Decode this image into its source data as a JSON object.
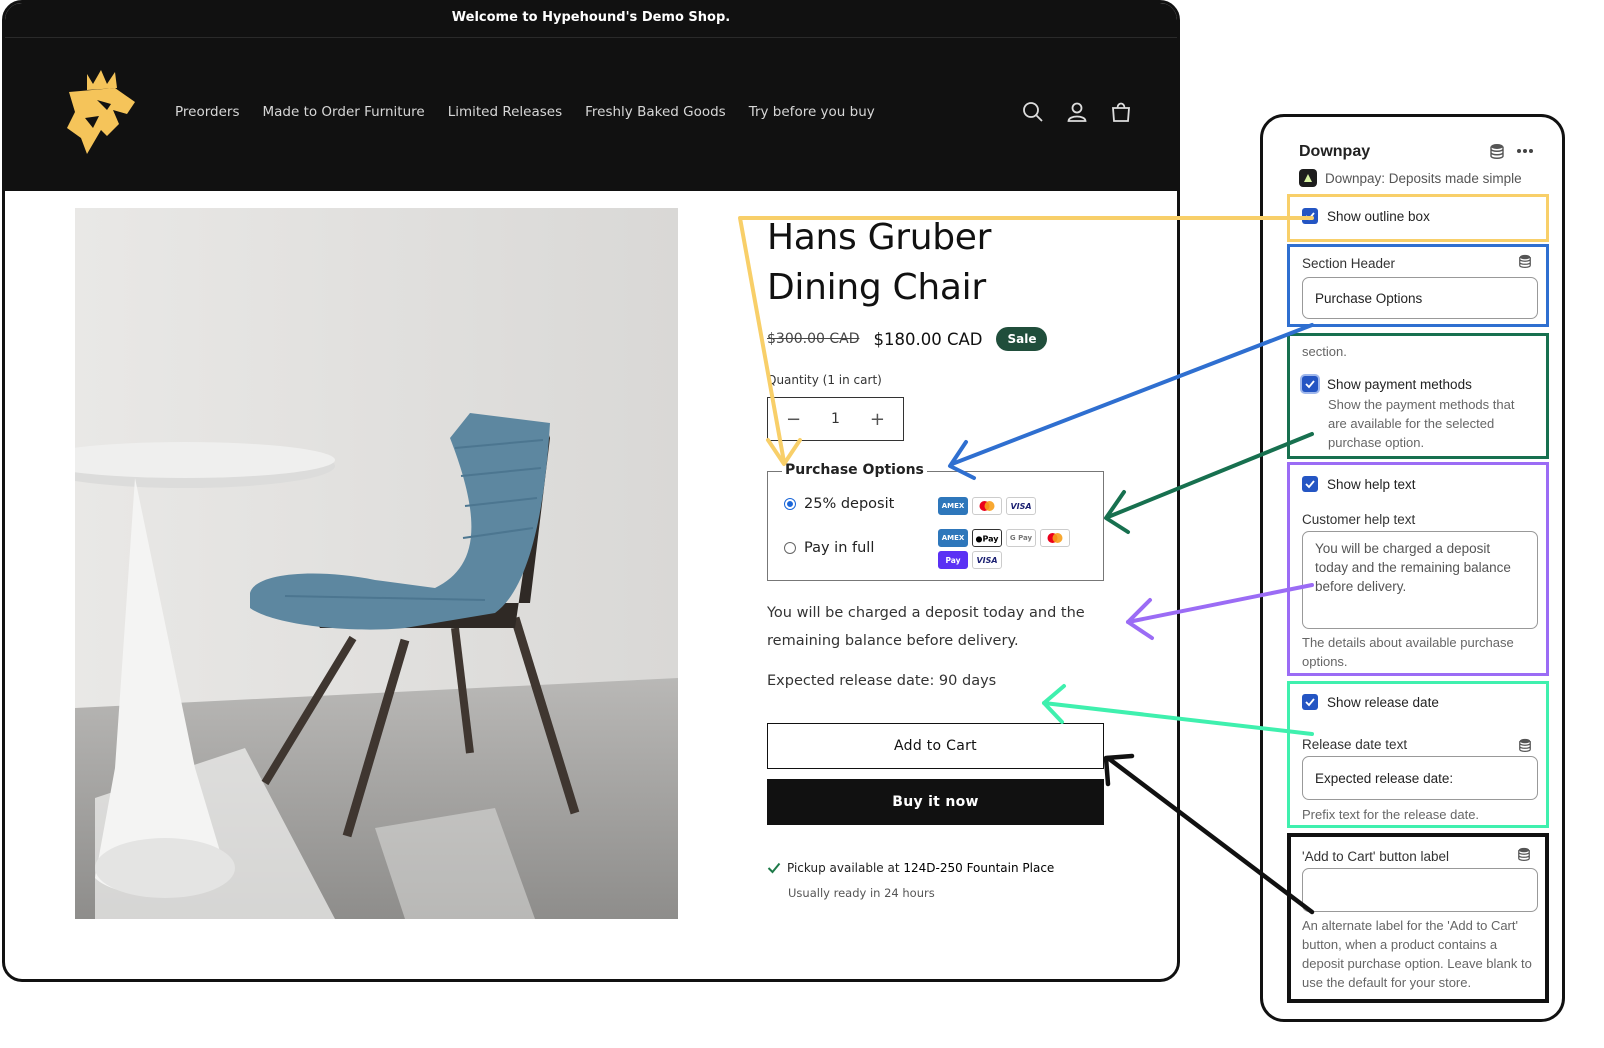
{
  "announcement": "Welcome to Hypehound's Demo Shop.",
  "nav": {
    "links": [
      "Preorders",
      "Made to Order Furniture",
      "Limited Releases",
      "Freshly Baked Goods",
      "Try before you buy"
    ],
    "icons": [
      "search-icon",
      "account-icon",
      "cart-icon"
    ]
  },
  "product": {
    "title": "Hans Gruber Dining Chair",
    "old_price": "$300.00 CAD",
    "price": "$180.00 CAD",
    "badge": "Sale",
    "quantity_label": "Quantity (1 in cart)",
    "quantity": "1",
    "decrement": "−",
    "increment": "+",
    "purchase_options": {
      "legend": "Purchase Options",
      "options": [
        {
          "label": "25% deposit",
          "selected": true,
          "payment_methods": [
            "AMEX",
            "Mastercard",
            "VISA"
          ]
        },
        {
          "label": "Pay in full",
          "selected": false,
          "payment_methods": [
            "AMEX",
            "Apple Pay",
            "G Pay",
            "Mastercard",
            "Shop Pay",
            "VISA"
          ]
        }
      ]
    },
    "help_text": "You will be charged a deposit today and the remaining balance before delivery.",
    "release_date": "Expected release date: 90 days",
    "add_to_cart": "Add to Cart",
    "buy_now": "Buy it now",
    "pickup_prefix": "Pickup available at ",
    "pickup_location": "124D-250 Fountain Place",
    "ready": "Usually ready in 24 hours"
  },
  "panel": {
    "title": "Downpay",
    "app_name": "Downpay: Deposits made simple",
    "show_outline_box": {
      "label": "Show outline box",
      "checked": true
    },
    "section_header": {
      "label": "Section Header",
      "value": "Purchase Options"
    },
    "section_tail": "section.",
    "show_payment_methods": {
      "label": "Show payment methods",
      "checked": true,
      "hint": "Show the payment methods that are available for the selected purchase option."
    },
    "show_help_text": {
      "label": "Show help text",
      "checked": true
    },
    "customer_help_text": {
      "label": "Customer help text",
      "value": "You will be charged a deposit today and the remaining balance before delivery.",
      "hint": "The details about available purchase options."
    },
    "show_release_date": {
      "label": "Show release date",
      "checked": true
    },
    "release_date_text": {
      "label": "Release date text",
      "value": "Expected release date:",
      "hint": "Prefix text for the release date."
    },
    "add_to_cart_label": {
      "label": "'Add to Cart' button label",
      "value": "",
      "hint": "An alternate label for the 'Add to Cart' button, when a product contains a deposit purchase option. Leave blank to use the default for your store."
    }
  },
  "colors": {
    "outline_box": "#f8cf69",
    "section_header": "#2f6fd0",
    "payment_methods": "#17704f",
    "help_text": "#9b6cf5",
    "release_date": "#3ff0ae",
    "add_to_cart": "#111111",
    "sale_badge": "#204e3b",
    "checkbox": "#2455c3"
  }
}
